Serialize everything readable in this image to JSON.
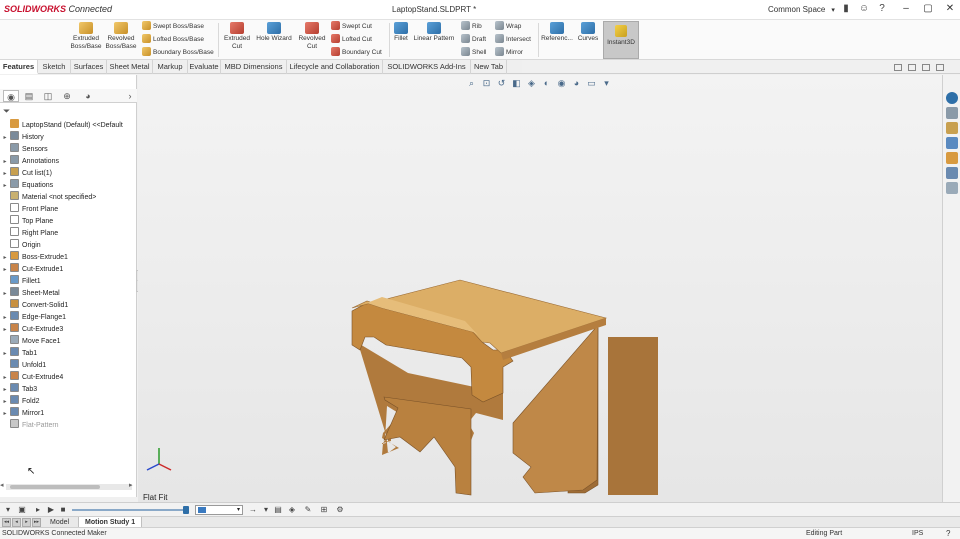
{
  "titlebar": {
    "brand_sw": "SOLIDWORKS",
    "brand_connected": "Connected",
    "document_title": "LaptopStand.SLDPRT *",
    "space": "Common Space"
  },
  "command_manager": {
    "extruded_boss": "Extruded\nBoss/Base",
    "revolved_boss": "Revolved\nBoss/Base",
    "swept_boss": "Swept Boss/Base",
    "lofted_boss": "Lofted Boss/Base",
    "boundary_boss": "Boundary Boss/Base",
    "extruded_cut": "Extruded\nCut",
    "hole_wizard": "Hole Wizard",
    "revolved_cut": "Revolved\nCut",
    "swept_cut": "Swept Cut",
    "lofted_cut": "Lofted Cut",
    "boundary_cut": "Boundary Cut",
    "fillet": "Fillet",
    "linear_pattern": "Linear Pattern",
    "rib": "Rib",
    "draft": "Draft",
    "shell": "Shell",
    "wrap": "Wrap",
    "intersect": "Intersect",
    "mirror": "Mirror",
    "reference": "Referenc...",
    "curves": "Curves",
    "instant3d": "Instant3D"
  },
  "tabs": [
    {
      "label": "Features",
      "active": true
    },
    {
      "label": "Sketch"
    },
    {
      "label": "Surfaces"
    },
    {
      "label": "Sheet Metal"
    },
    {
      "label": "Markup"
    },
    {
      "label": "Evaluate"
    },
    {
      "label": "MBD Dimensions"
    },
    {
      "label": "Lifecycle and Collaboration"
    },
    {
      "label": "SOLIDWORKS Add-Ins"
    },
    {
      "label": "New Tab"
    }
  ],
  "feature_tree": {
    "root": "LaptopStand (Default) <<Default",
    "items": [
      {
        "label": "History",
        "arrow": "▸",
        "icon": "history-icon",
        "color": "#7a8a9a"
      },
      {
        "label": "Sensors",
        "arrow": "",
        "icon": "sensor-icon",
        "color": "#8a9aa8"
      },
      {
        "label": "Annotations",
        "arrow": "▸",
        "icon": "annotation-icon",
        "color": "#8a9aa8"
      },
      {
        "label": "Cut list(1)",
        "arrow": "▸",
        "icon": "cutlist-icon",
        "color": "#c8a050"
      },
      {
        "label": "Equations",
        "arrow": "▸",
        "icon": "equation-icon",
        "color": "#8a9aa8"
      },
      {
        "label": "Material <not specified>",
        "arrow": "",
        "icon": "material-icon",
        "color": "#c8b070"
      },
      {
        "label": "Front Plane",
        "arrow": "",
        "icon": "plane-icon",
        "color": "#ffffff"
      },
      {
        "label": "Top Plane",
        "arrow": "",
        "icon": "plane-icon",
        "color": "#ffffff"
      },
      {
        "label": "Right Plane",
        "arrow": "",
        "icon": "plane-icon",
        "color": "#ffffff"
      },
      {
        "label": "Origin",
        "arrow": "",
        "icon": "origin-icon",
        "color": "#ffffff"
      },
      {
        "label": "Boss-Extrude1",
        "arrow": "▸",
        "icon": "boss-extrude-icon",
        "color": "#d89a40"
      },
      {
        "label": "Cut-Extrude1",
        "arrow": "▸",
        "icon": "cut-extrude-icon",
        "color": "#c8844a"
      },
      {
        "label": "Fillet1",
        "arrow": "",
        "icon": "fillet-icon",
        "color": "#6a9ac8"
      },
      {
        "label": "Sheet-Metal",
        "arrow": "▸",
        "icon": "sheet-metal-icon",
        "color": "#7a8a98"
      },
      {
        "label": "Convert-Solid1",
        "arrow": "",
        "icon": "convert-solid-icon",
        "color": "#c89040"
      },
      {
        "label": "Edge-Flange1",
        "arrow": "▸",
        "icon": "edge-flange-icon",
        "color": "#6a8ab0"
      },
      {
        "label": "Cut-Extrude3",
        "arrow": "▸",
        "icon": "cut-extrude-icon",
        "color": "#c8844a"
      },
      {
        "label": "Move Face1",
        "arrow": "",
        "icon": "move-face-icon",
        "color": "#9aaab8"
      },
      {
        "label": "Tab1",
        "arrow": "▸",
        "icon": "tab-icon",
        "color": "#6a8ab0"
      },
      {
        "label": "Unfold1",
        "arrow": "",
        "icon": "unfold-icon",
        "color": "#6a8ab0"
      },
      {
        "label": "Cut-Extrude4",
        "arrow": "▸",
        "icon": "cut-extrude-icon",
        "color": "#c8844a"
      },
      {
        "label": "Tab3",
        "arrow": "▸",
        "icon": "tab-icon",
        "color": "#6a8ab0"
      },
      {
        "label": "Fold2",
        "arrow": "▸",
        "icon": "fold-icon",
        "color": "#6a8ab0"
      },
      {
        "label": "Mirror1",
        "arrow": "▸",
        "icon": "mirror-icon",
        "color": "#6a8ab0"
      },
      {
        "label": "Flat-Pattern",
        "arrow": "",
        "icon": "flat-pattern-icon",
        "color": "#c8c8c8",
        "dim": true
      }
    ]
  },
  "graphics": {
    "view_label": "Flat Fit"
  },
  "motion_bar": {
    "doc_tabs": [
      {
        "label": "Model"
      },
      {
        "label": "Motion Study 1",
        "active": true
      }
    ]
  },
  "status": {
    "left": "SOLIDWORKS Connected Maker",
    "mode": "Editing Part",
    "units": "IPS",
    "help": "?"
  },
  "colors": {
    "brand": "#c8102e",
    "model_top": "#d9a65a",
    "model_front": "#b57e3f",
    "model_side": "#9a6a33",
    "viewport_bg": "#ebebeb"
  }
}
